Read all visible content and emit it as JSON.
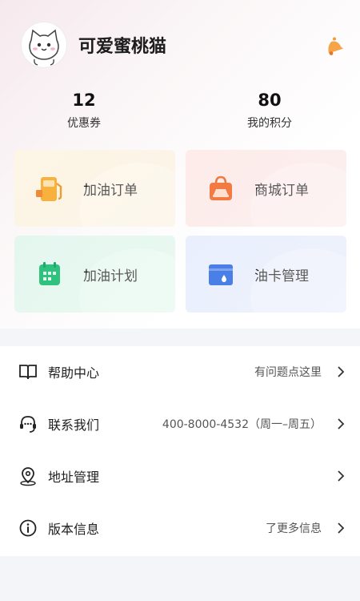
{
  "profile": {
    "username": "可爱蜜桃猫",
    "avatar_icon": "cat-avatar",
    "bell_icon": "bell-icon"
  },
  "stats": {
    "coupons": {
      "value": "12",
      "label": "优惠券"
    },
    "points": {
      "value": "80",
      "label": "我的积分"
    }
  },
  "cards": {
    "fuel_orders": {
      "label": "加油订单",
      "icon": "fuel-pump-icon",
      "color": "#f5a623"
    },
    "mall_orders": {
      "label": "商城订单",
      "icon": "shopping-bag-icon",
      "color": "#f27a43"
    },
    "fuel_plan": {
      "label": "加油计划",
      "icon": "calendar-icon",
      "color": "#2ec27e"
    },
    "card_mgmt": {
      "label": "油卡管理",
      "icon": "fuel-card-icon",
      "color": "#4a7fe8"
    }
  },
  "menu": {
    "help": {
      "label": "帮助中心",
      "value": "有问题点这里",
      "icon": "book-icon"
    },
    "contact": {
      "label": "联系我们",
      "value": "400-8000-4532（周一–周五）",
      "icon": "headset-icon"
    },
    "address": {
      "label": "地址管理",
      "value": "",
      "icon": "location-pin-icon"
    },
    "version": {
      "label": "版本信息",
      "value": "了更多信息",
      "icon": "info-icon"
    }
  }
}
